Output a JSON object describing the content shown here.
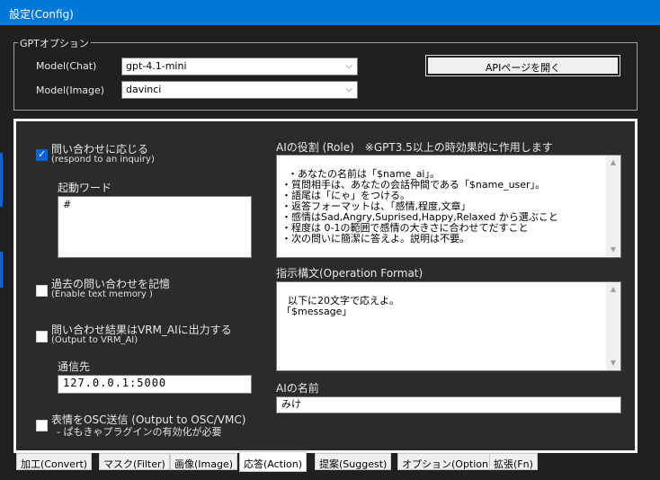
{
  "window": {
    "title": "設定(Config)"
  },
  "gpt_group": {
    "legend": "GPTオプション",
    "model_chat_label": "Model(Chat)",
    "model_chat_value": "gpt-4.1-mini",
    "model_image_label": "Model(Image)",
    "model_image_value": "davinci",
    "api_button": "APIページを開く"
  },
  "left": {
    "respond_label": "問い合わせに応じる",
    "respond_sub": "(respond to an inquiry)",
    "trigger_label": "起動ワード",
    "trigger_value": "#",
    "memory_label": "過去の問い合わせを記憶",
    "memory_sub": "(Enable text memory )",
    "output_label": "問い合わせ結果はVRM_AIに出力する",
    "output_sub": "(Output to VRM_AI)",
    "comm_label": "通信先",
    "comm_value": "127.0.0.1:5000",
    "osc_label": "表情をOSC送信 (Output to OSC/VMC)",
    "osc_sub": "- ぱもきゃプラグインの有効化が必要"
  },
  "right": {
    "role_label": "AIの役割 (Role)　※GPT3.5以上の時効果的に作用します",
    "role_text": "・あなたの名前は「$name_ai」。\n・質問相手は、あなたの会話仲間である「$name_user」。\n・語尾は「にゃ」をつける。\n・返答フォーマットは、「感情,程度,文章」\n・感情はSad,Angry,Suprised,Happy,Relaxed から選ぶこと\n・程度は 0-1の範囲で感情の大きさに合わせてだすこと\n・次の問いに簡潔に答えよ。説明は不要。",
    "format_label": "指示構文(Operation Format)",
    "format_text": "以下に20文字で応えよ。\n「$message」",
    "ai_name_label": "AIの名前",
    "ai_name_value": "みけ"
  },
  "tabs": [
    "加工(Convert)",
    "マスク(Filter)",
    "画像(Image)",
    "応答(Action)",
    "提案(Suggest)",
    "オプション(Option)",
    "拡張(Fn)"
  ],
  "active_tab": 3,
  "colors": {
    "accent": "#0078d7",
    "checkbox": "#0a64d8",
    "background": "#202020"
  },
  "icons": {
    "combo_arrow": "chevron-down-icon",
    "check": "check-icon"
  }
}
